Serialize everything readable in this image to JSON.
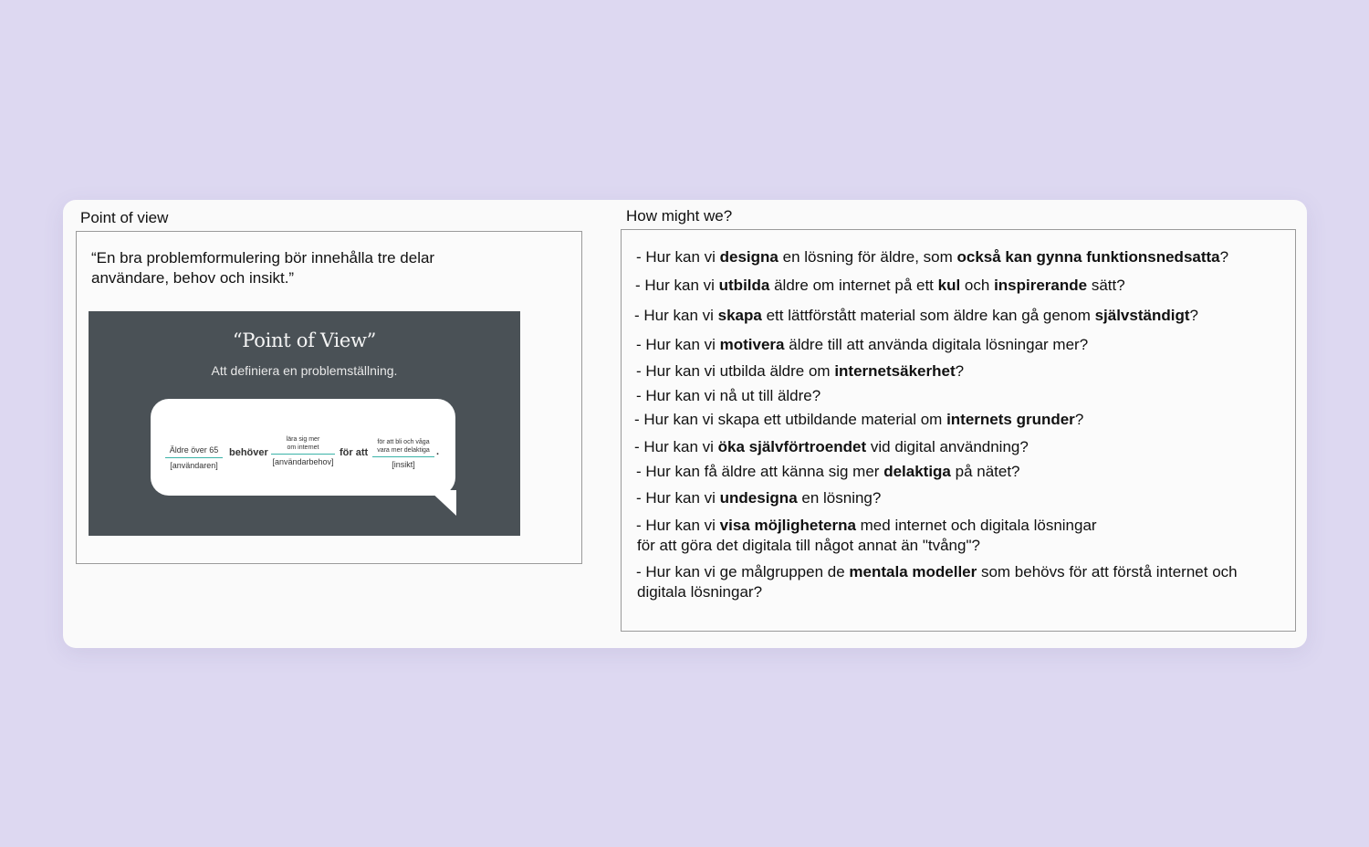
{
  "pov": {
    "label": "Point of view",
    "quote_line1": "“En bra problemformulering bör innehålla tre delar",
    "quote_line2": "användare, behov och insikt.”",
    "slide": {
      "title": "“Point of View”",
      "subtitle": "Att definiera en problemställning.",
      "user_value": "Äldre över 65",
      "user_caption": "[användaren]",
      "needs_word": "behöver",
      "need_value_line1": "lära sig mer",
      "need_value_line2": "om internet",
      "need_caption": "[användarbehov]",
      "for_word": "för att",
      "insight_value_line1": "för att bli och våga",
      "insight_value_line2": "vara mer delaktiga",
      "insight_caption": "[insikt]",
      "period": "."
    }
  },
  "hmw": {
    "label": "How might we?",
    "items": [
      [
        {
          "t": "- Hur kan vi "
        },
        {
          "t": "designa",
          "b": true
        },
        {
          "t": " en lösning för äldre, som "
        },
        {
          "t": "också kan gynna funktionsnedsatta",
          "b": true
        },
        {
          "t": "?"
        }
      ],
      [
        {
          "t": "- Hur kan vi "
        },
        {
          "t": "utbilda",
          "b": true
        },
        {
          "t": " äldre om internet på ett "
        },
        {
          "t": "kul",
          "b": true
        },
        {
          "t": " och "
        },
        {
          "t": "inspirerande",
          "b": true
        },
        {
          "t": " sätt?"
        }
      ],
      [
        {
          "t": "- Hur kan vi "
        },
        {
          "t": "skapa",
          "b": true
        },
        {
          "t": " ett lättförstått material som äldre kan gå genom "
        },
        {
          "t": "självständigt",
          "b": true
        },
        {
          "t": "?"
        }
      ],
      [
        {
          "t": "- Hur kan vi "
        },
        {
          "t": "motivera",
          "b": true
        },
        {
          "t": " äldre till att använda digitala lösningar mer?"
        }
      ],
      [
        {
          "t": "- Hur kan vi utbilda äldre om "
        },
        {
          "t": "internetsäkerhet",
          "b": true
        },
        {
          "t": "?"
        }
      ],
      [
        {
          "t": "- Hur kan vi nå ut till äldre?"
        }
      ],
      [
        {
          "t": "- Hur kan vi skapa ett utbildande material om "
        },
        {
          "t": "internets grunder",
          "b": true
        },
        {
          "t": "?"
        }
      ],
      [
        {
          "t": "- Hur kan vi "
        },
        {
          "t": "öka självförtroendet",
          "b": true
        },
        {
          "t": " vid digital användning?"
        }
      ],
      [
        {
          "t": "- Hur kan få äldre att känna sig mer "
        },
        {
          "t": "delaktiga",
          "b": true
        },
        {
          "t": " på nätet?"
        }
      ],
      [
        {
          "t": "- Hur kan vi "
        },
        {
          "t": "undesigna",
          "b": true
        },
        {
          "t": " en lösning?"
        }
      ],
      [
        {
          "t": "- Hur kan vi "
        },
        {
          "t": "visa möjligheterna",
          "b": true
        },
        {
          "t": " med internet och digitala lösningar"
        }
      ],
      [
        {
          "t": "för att göra det digitala till något annat än \"tvång\"?"
        }
      ],
      [
        {
          "t": "- Hur kan vi ge målgruppen de "
        },
        {
          "t": "mentala modeller",
          "b": true
        },
        {
          "t": " som behövs för att förstå internet och"
        }
      ],
      [
        {
          "t": "digitala lösningar?"
        }
      ]
    ]
  }
}
